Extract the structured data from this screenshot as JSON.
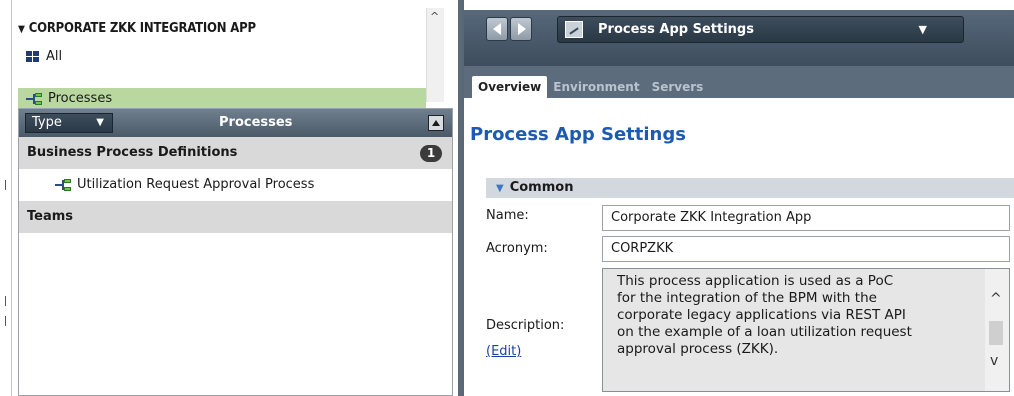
{
  "tree": {
    "root_label": "CORPORATE ZKK INTEGRATION APP",
    "items": [
      {
        "label": "All",
        "icon": "grid-icon"
      },
      {
        "label": "Processes",
        "icon": "process-icon"
      }
    ]
  },
  "library": {
    "type_label": "Type",
    "title": "Processes",
    "sections": [
      {
        "label": "Business Process Definitions",
        "count": "1",
        "items": [
          "Utilization Request Approval Process"
        ]
      },
      {
        "label": "Teams",
        "count": "",
        "items": []
      }
    ]
  },
  "toolbar": {
    "title": "Process App Settings"
  },
  "tabs": [
    {
      "label": "Overview",
      "active": true
    },
    {
      "label": "Environment",
      "active": false
    },
    {
      "label": "Servers",
      "active": false
    }
  ],
  "page": {
    "title": "Process App Settings",
    "section_title": "Common",
    "fields": {
      "name_label": "Name:",
      "name_value": "Corporate ZKK Integration App",
      "acronym_label": "Acronym:",
      "acronym_value": "CORPZKK",
      "description_label": "Description:",
      "description_lines": [
        "This process application is used as a PoC",
        "for the integration of the BPM with the",
        "corporate legacy applications via REST API",
        "on the example of a loan utilization request",
        "approval process (ZKK)."
      ],
      "edit_label": "(Edit)"
    }
  },
  "colors": {
    "selected_row": "#b8d8a0",
    "title_blue": "#1c5bb0",
    "header_dark": "#4a5a69"
  }
}
